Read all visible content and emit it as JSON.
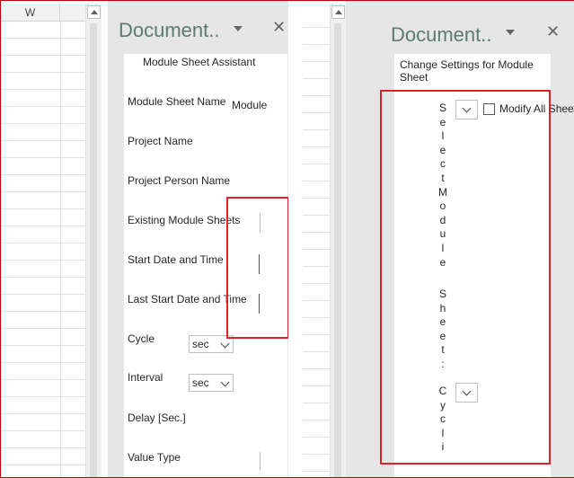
{
  "left_sheet": {
    "column_label": "W"
  },
  "left_pane": {
    "title": "Document..",
    "caret_icon": "dropdown-caret-icon",
    "close_symbol": "✕",
    "panel_title": "Module Sheet Assistant",
    "fields": {
      "module_sheet_name_label": "Module Sheet Name",
      "module_sheet_name_value": "Module",
      "project_name_label": "Project Name",
      "project_person_name_label": "Project Person Name",
      "existing_module_sheets_label": "Existing Module Sheets",
      "start_date_label": "Start Date and Time",
      "last_start_date_label": "Last Start Date and Time",
      "cycle_label": "Cycle",
      "cycle_unit": "sec",
      "interval_label": "Interval",
      "interval_unit": "sec",
      "delay_label": "Delay [Sec.]",
      "value_type_label": "Value Type"
    }
  },
  "right_pane": {
    "title": "Document..",
    "close_symbol": "✕",
    "panel_title_line1": "Change Settings for Module",
    "panel_title_line2": "Sheet",
    "select_label_chars": [
      "S",
      "e",
      "l",
      "e",
      "c",
      "t",
      "M",
      "o",
      "d",
      "u",
      "l",
      "e"
    ],
    "sheet_label_chars": [
      "S",
      "h",
      "e",
      "e",
      "t",
      ":"
    ],
    "cycle_label_chars": [
      "C",
      "y",
      "c",
      "l",
      "i"
    ],
    "modify_all_label": "Modify All Sheets"
  },
  "colors": {
    "highlight": "#e0202a",
    "pane_title": "#5b7b6f",
    "pane_bg": "#e6e6e6"
  }
}
